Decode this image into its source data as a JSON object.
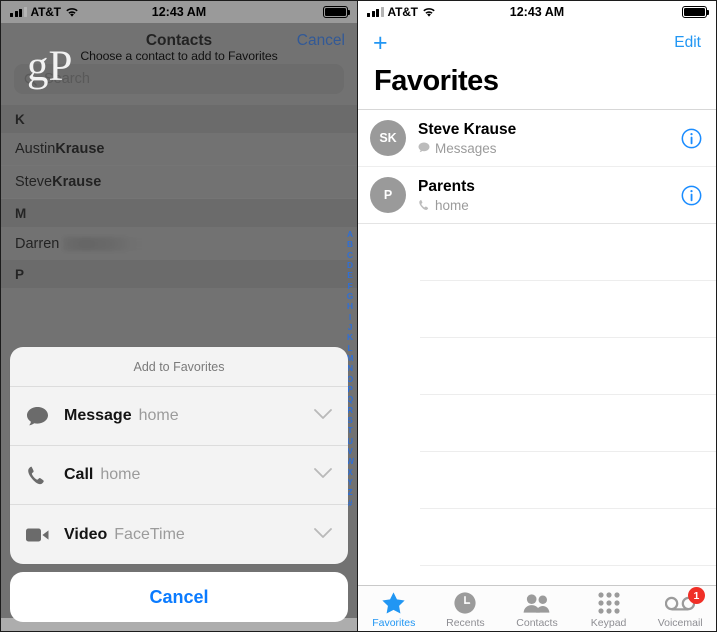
{
  "status_bar": {
    "carrier": "AT&T",
    "time": "12:43 AM",
    "signal_icon": "signal-bars-icon",
    "wifi_icon": "wifi-icon",
    "battery_icon": "battery-full-icon"
  },
  "left_screen": {
    "watermark": "gP",
    "prompt": "Choose a contact to add to Favorites",
    "nav": {
      "title": "Contacts",
      "cancel_label": "Cancel"
    },
    "search": {
      "placeholder": "Search",
      "icon": "search-icon"
    },
    "contacts": [
      {
        "type": "section",
        "label": "K"
      },
      {
        "type": "contact",
        "first": "Austin ",
        "last": "Krause",
        "blurred": false
      },
      {
        "type": "contact",
        "first": "Steve ",
        "last": "Krause",
        "blurred": false
      },
      {
        "type": "section",
        "label": "M"
      },
      {
        "type": "contact",
        "first": "Darren ",
        "last": "",
        "blurred": true
      },
      {
        "type": "section",
        "label": "P"
      }
    ],
    "index_letters": [
      "A",
      "B",
      "C",
      "D",
      "E",
      "F",
      "G",
      "H",
      "I",
      "J",
      "K",
      "L",
      "M",
      "N",
      "O",
      "P",
      "Q",
      "R",
      "S",
      "T",
      "U",
      "V",
      "W",
      "X",
      "Y",
      "Z",
      "#"
    ],
    "action_sheet": {
      "title": "Add to Favorites",
      "rows": [
        {
          "label": "Message",
          "detail": "home",
          "icon": "message-bubble-icon",
          "chevron": "chevron-down-icon"
        },
        {
          "label": "Call",
          "detail": "home",
          "icon": "phone-handset-icon",
          "chevron": "chevron-down-icon"
        },
        {
          "label": "Video",
          "detail": "FaceTime",
          "icon": "video-camera-icon",
          "chevron": "chevron-down-icon"
        }
      ],
      "cancel_label": "Cancel"
    }
  },
  "right_screen": {
    "nav": {
      "add_label": "+",
      "add_icon": "plus-icon",
      "edit_label": "Edit"
    },
    "title": "Favorites",
    "favorites": [
      {
        "initials": "SK",
        "name": "Steve Krause",
        "detail": "Messages",
        "detail_icon": "message-bubble-icon",
        "info_icon": "info-circle-icon"
      },
      {
        "initials": "P",
        "name": "Parents",
        "detail": "home",
        "detail_icon": "phone-handset-icon",
        "info_icon": "info-circle-icon"
      }
    ],
    "empty_row_count": 6,
    "tabs": [
      {
        "label": "Favorites",
        "icon": "star-icon",
        "active": true,
        "badge": null
      },
      {
        "label": "Recents",
        "icon": "clock-icon",
        "active": false,
        "badge": null
      },
      {
        "label": "Contacts",
        "icon": "people-icon",
        "active": false,
        "badge": null
      },
      {
        "label": "Keypad",
        "icon": "keypad-icon",
        "active": false,
        "badge": null
      },
      {
        "label": "Voicemail",
        "icon": "voicemail-icon",
        "active": false,
        "badge": "1"
      }
    ]
  },
  "colors": {
    "ios_blue": "#2196f3",
    "link_blue": "#0a7bff",
    "badge_red": "#f02f27",
    "dim_overlay": "#9a9a9a",
    "gray_text": "#9b9b9b"
  }
}
